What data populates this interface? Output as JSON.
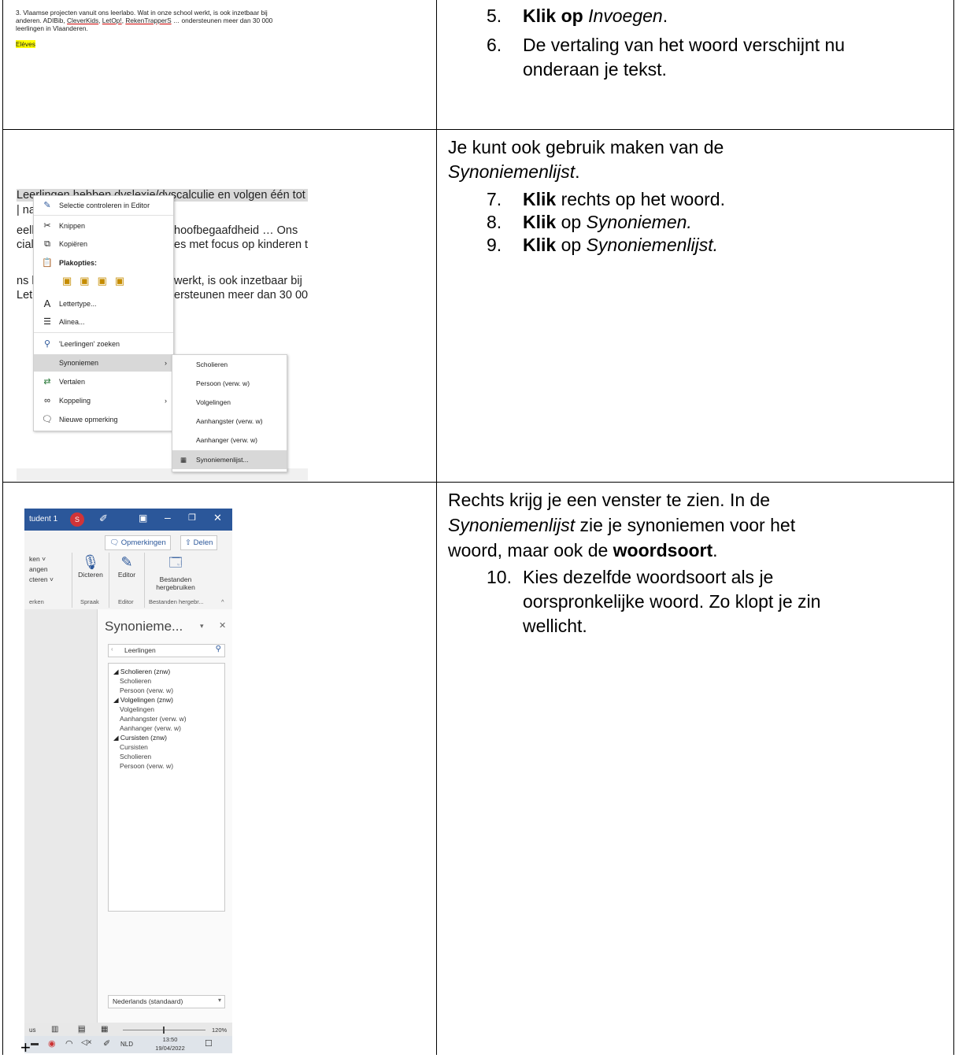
{
  "cell1": {
    "paragraph": "3. Vlaamse projecten vanuit ons leerlabo. Wat in onze school werkt, is ook inzetbaar bij anderen. ADIBib, CleverKids, LetOp!, RekenTrapperS … ondersteunen meer dan 30 000 leerlingen in Vlaanderen.",
    "line1": "3. Vlaamse projecten vanuit ons leerlabo. Wat in onze school werkt, is ook inzetbaar bij",
    "line2_a": "anderen. ADIBib, ",
    "line2_cleverkids": "CleverKids",
    "line2_sep1": ", ",
    "line2_letop": "LetOp!",
    "line2_sep2": ", ",
    "line2_rekentrappers": "RekenTrapperS",
    "line2_b": " … ondersteunen meer dan 30 000",
    "line3": "leerlingen in Vlaanderen.",
    "highlight": "Elèves",
    "steps": [
      {
        "num": "5.",
        "bold": "Klik op",
        "italic": "Invoegen",
        "rest": "."
      },
      {
        "num": "6.",
        "text": "De vertaling van het woord verschijnt nu",
        "text2": "onderaan je tekst."
      }
    ]
  },
  "cell2": {
    "doc_lines": [
      "Leerlingen hebben dyslexie/dyscalculie en volgen één tot t",
      "| na",
      "eelli",
      "cial",
      "hoofbegaafdheid … Ons",
      "es met focus op kinderen t",
      "ns le",
      "werkt, is ook inzetbaar bij",
      "LetC",
      "ersteunen meer dan 30 00("
    ],
    "context_menu": {
      "editor": "Selectie controleren in Editor",
      "knippen": "Knippen",
      "kopieren": "Kopiëren",
      "plakopties": "Plakopties:",
      "lettertype": "Lettertype...",
      "alinea": "Alinea...",
      "zoeken": "'Leerlingen' zoeken",
      "synoniemen": "Synoniemen",
      "vertalen": "Vertalen",
      "koppeling": "Koppeling",
      "opmerking": "Nieuwe opmerking"
    },
    "submenu": [
      "Scholieren",
      "Persoon (verw. w)",
      "Volgelingen",
      "Aanhangster (verw. w)",
      "Aanhanger (verw. w)",
      "Synoniemenlijst..."
    ],
    "intro1": "Je kunt ook gebruik maken van de",
    "intro2_italic": "Synoniemenlijst",
    "intro2_rest": ".",
    "steps": [
      {
        "num": "7.",
        "bold": "Klik",
        "rest": " rechts op het woord."
      },
      {
        "num": "8.",
        "bold": "Klik",
        "rest": " op ",
        "italic": "Synoniemen."
      },
      {
        "num": "9.",
        "bold": "Klik",
        "rest": " op ",
        "italic": "Synoniemenlijst."
      }
    ]
  },
  "cell3": {
    "word": {
      "user": "tudent 1",
      "avatar": "S",
      "opmerkingen": "Opmerkingen",
      "delen": "Delen",
      "ribbon_left": [
        "ken ˅",
        "angen",
        "cteren ˅",
        "erken"
      ],
      "dicteren": "Dicteren",
      "editor": "Editor",
      "bestanden1": "Bestanden",
      "bestanden2": "hergebruiken",
      "group_spraak": "Spraak",
      "group_editor": "Editor",
      "group_bestanden": "Bestanden hergebr...",
      "pane_title": "Synonieme...",
      "search_value": "Leerlingen",
      "list": [
        {
          "t": "◢ Scholieren (znw)",
          "h": true
        },
        {
          "t": "Scholieren"
        },
        {
          "t": "Persoon (verw. w)"
        },
        {
          "t": "◢ Volgelingen (znw)",
          "h": true
        },
        {
          "t": "Volgelingen"
        },
        {
          "t": "Aanhangster (verw. w)"
        },
        {
          "t": "Aanhanger (verw. w)"
        },
        {
          "t": "◢ Cursisten (znw)",
          "h": true
        },
        {
          "t": "Cursisten"
        },
        {
          "t": "Scholieren"
        },
        {
          "t": "Persoon (verw. w)"
        }
      ],
      "language": "Nederlands (standaard)",
      "status_left": "us",
      "zoom": "120%",
      "lang_tb": "NLD",
      "time": "13:50",
      "date": "19/04/2022"
    },
    "intro1": "Rechts krijg je een venster te zien. In de",
    "intro2_italic": "Synoniemenlijst",
    "intro2_rest": " zie je synoniemen voor het",
    "intro3_a": "woord, maar ook de ",
    "intro3_bold": "woordsoort",
    "intro3_b": ".",
    "step": {
      "num": "10.",
      "line1": "Kies dezelfde woordsoort als je",
      "line2": "oorspronkelijke woord. Zo klopt je zin",
      "line3": "wellicht."
    }
  }
}
